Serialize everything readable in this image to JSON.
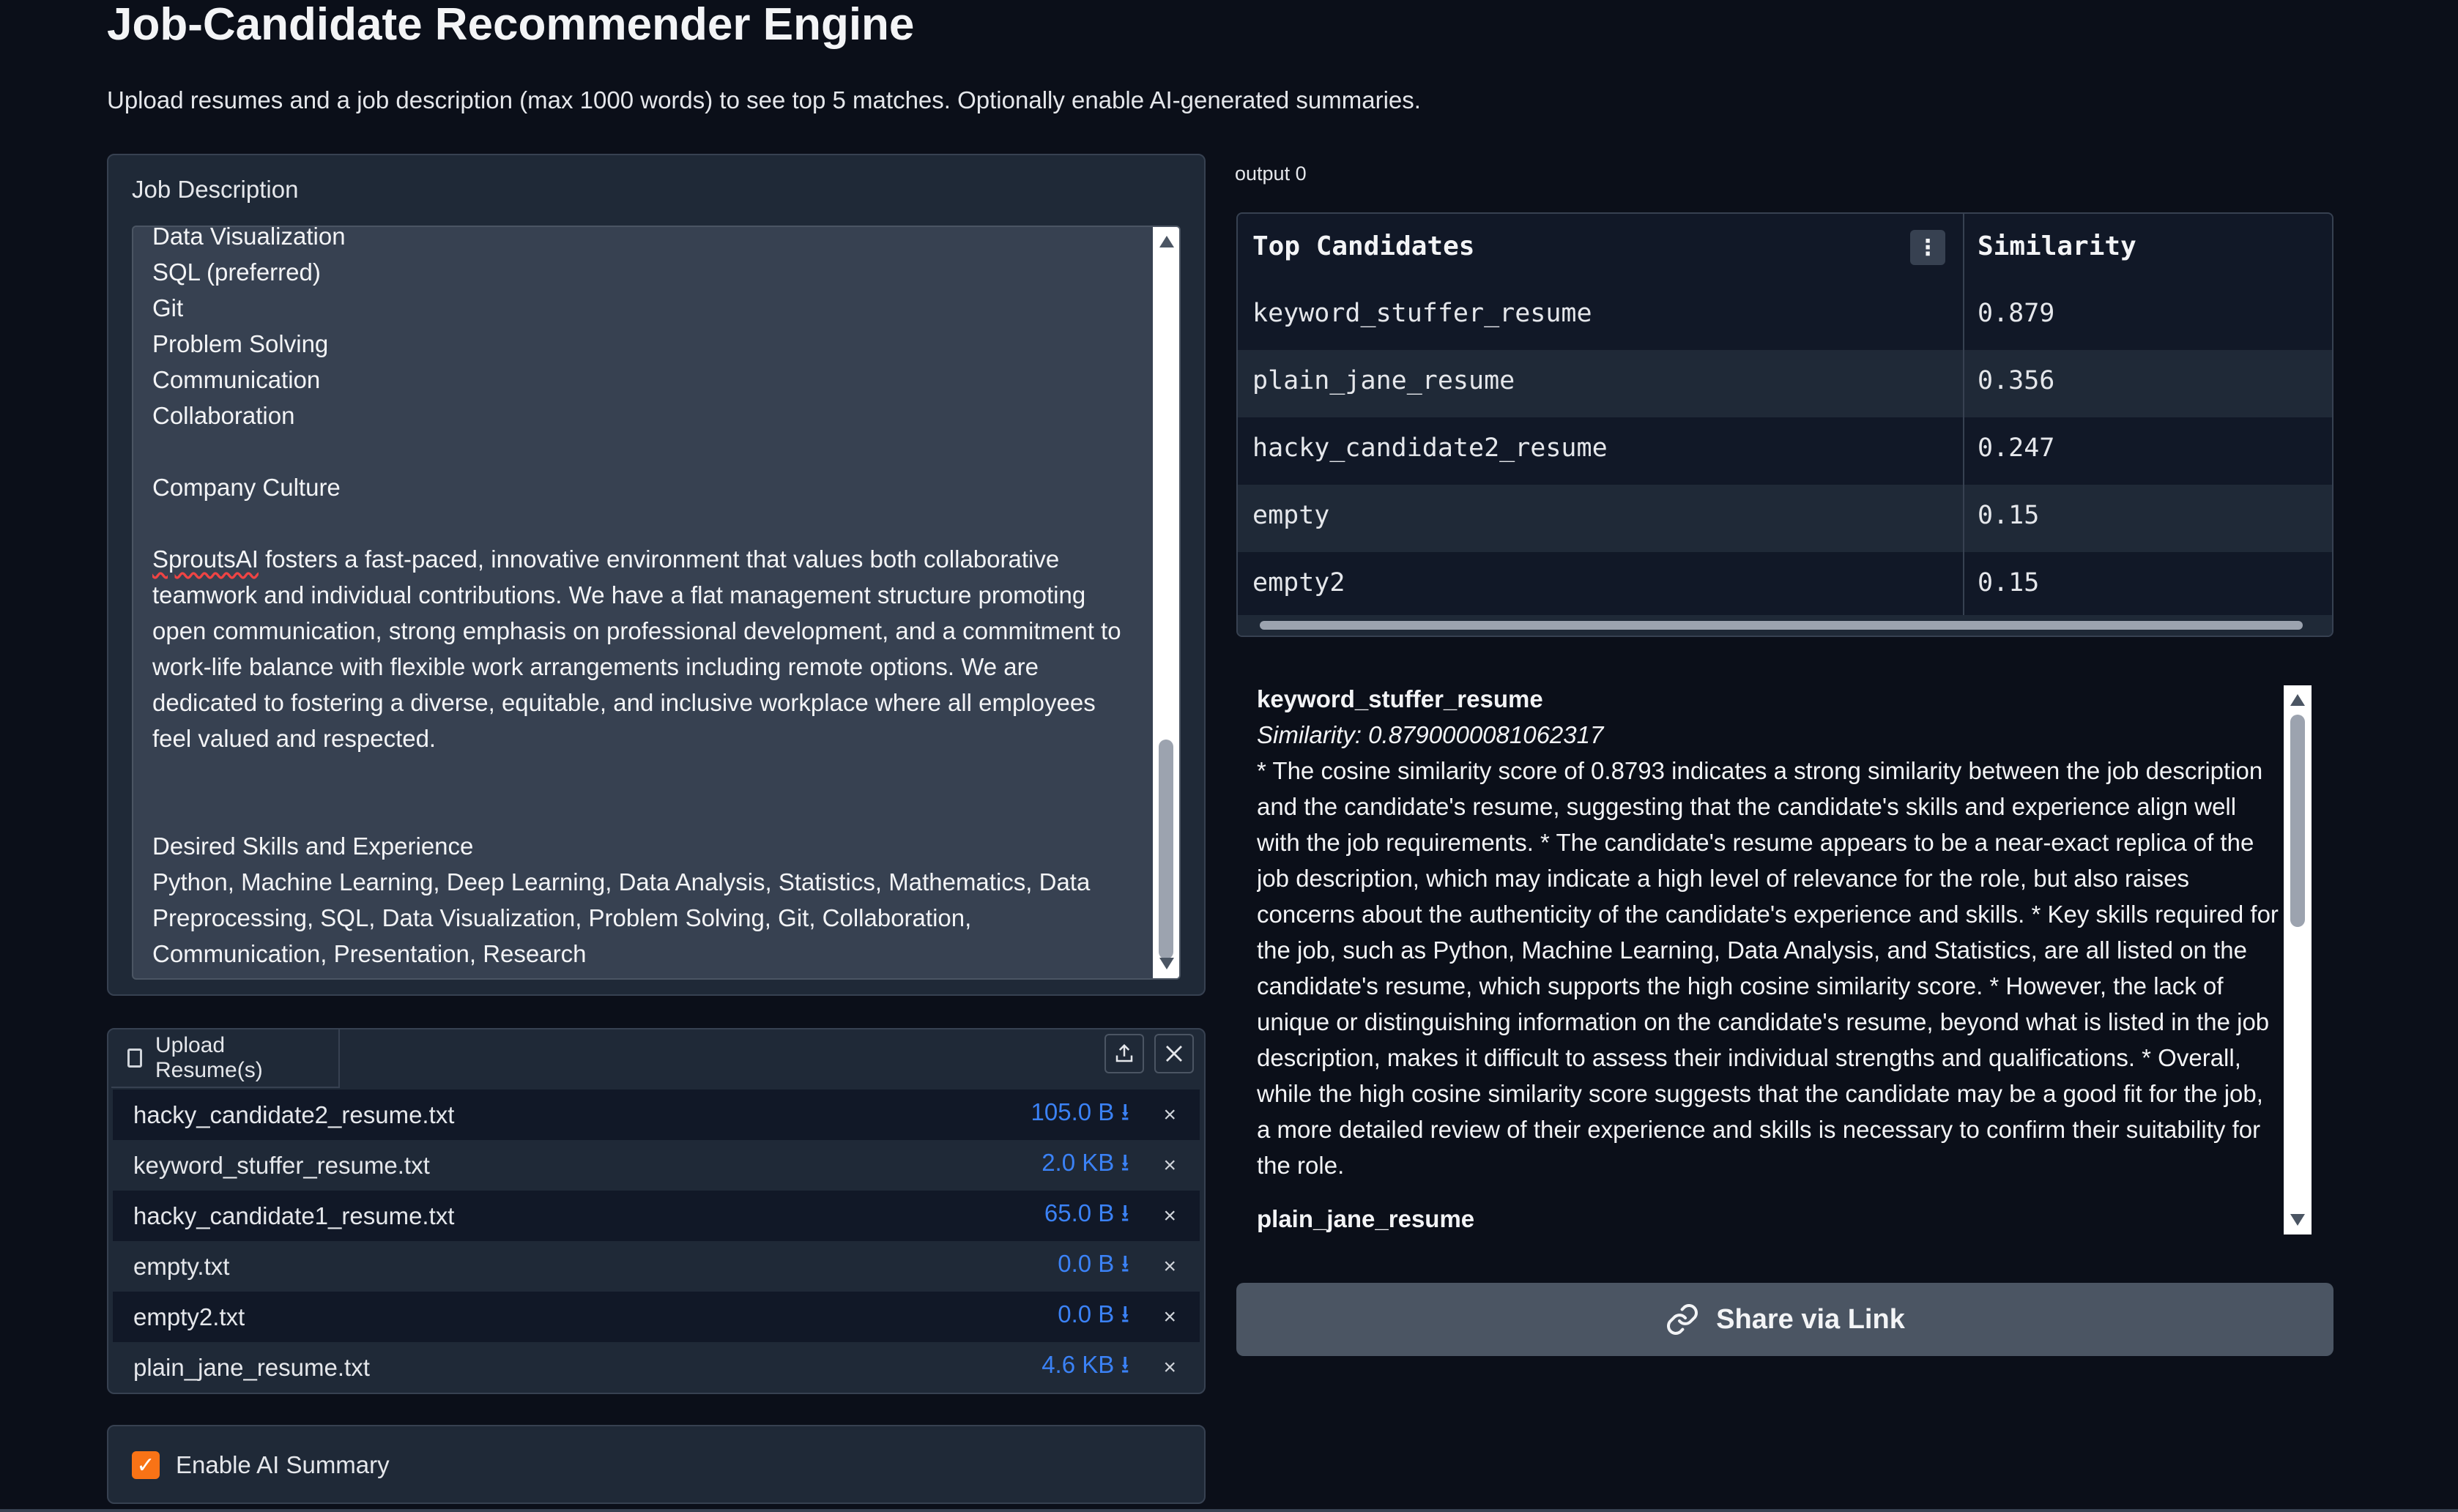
{
  "app": {
    "title": "Job-Candidate Recommender Engine",
    "subtitle": "Upload resumes and a job description (max 1000 words) to see top 5 matches. Optionally enable AI-generated summaries."
  },
  "job_description": {
    "label": "Job Description",
    "lines_before": "Data Visualization\nSQL (preferred)\nGit\nProblem Solving\nCommunication\nCollaboration\n\nCompany Culture\n\n",
    "misspelled_word": "SproutsAI",
    "lines_after": " fosters a fast-paced, innovative environment that values both collaborative\nteamwork and individual contributions. We have a flat management structure promoting\nopen communication, strong emphasis on professional development, and a commitment to\nwork-life balance with flexible work arrangements including remote options. We are\ndedicated to fostering a diverse, equitable, and inclusive workplace where all employees\nfeel valued and respected.\n\n\nDesired Skills and Experience\nPython, Machine Learning, Deep Learning, Data Analysis, Statistics, Mathematics, Data\nPreprocessing, SQL, Data Visualization, Problem Solving, Git, Collaboration,\nCommunication, Presentation, Research"
  },
  "upload": {
    "tab_label": "Upload Resume(s)",
    "upload_icon": "upload-icon",
    "clear_icon": "close-icon",
    "files": [
      {
        "name": "hacky_candidate2_resume.txt",
        "size": "105.0 B ⭳"
      },
      {
        "name": "keyword_stuffer_resume.txt",
        "size": "2.0 KB ⭳"
      },
      {
        "name": "hacky_candidate1_resume.txt",
        "size": "65.0 B ⭳"
      },
      {
        "name": "empty.txt",
        "size": "0.0 B ⭳"
      },
      {
        "name": "empty2.txt",
        "size": "0.0 B ⭳"
      },
      {
        "name": "plain_jane_resume.txt",
        "size": "4.6 KB ⭳"
      }
    ],
    "remove_glyph": "×"
  },
  "checkbox": {
    "label": "Enable AI Summary",
    "checked": true,
    "accent": "#f97316"
  },
  "output": {
    "label": "output 0",
    "headers": [
      "Top Candidates",
      "Similarity"
    ],
    "menu_glyph": "⋮",
    "rows": [
      {
        "candidate": "keyword_stuffer_resume",
        "similarity": "0.879"
      },
      {
        "candidate": "plain_jane_resume",
        "similarity": "0.356"
      },
      {
        "candidate": "hacky_candidate2_resume",
        "similarity": "0.247"
      },
      {
        "candidate": "empty",
        "similarity": "0.15"
      },
      {
        "candidate": "empty2",
        "similarity": "0.15"
      }
    ]
  },
  "summary": {
    "name": "keyword_stuffer_resume",
    "similarity": "Similarity: 0.8790000081062317",
    "body": "* The cosine similarity score of 0.8793 indicates a strong similarity between the job description and the candidate's resume, suggesting that the candidate's skills and experience align well with the job requirements. * The candidate's resume appears to be a near-exact replica of the job description, which may indicate a high level of relevance for the role, but also raises concerns about the authenticity of the candidate's experience and skills. * Key skills required for the job, such as Python, Machine Learning, Data Analysis, and Statistics, are all listed on the candidate's resume, which supports the high cosine similarity score. * However, the lack of unique or distinguishing information on the candidate's resume, beyond what is listed in the job description, makes it difficult to assess their individual strengths and qualifications. * Overall, while the high cosine similarity score suggests that the candidate may be a good fit for the job, a more detailed review of their experience and skills is necessary to confirm their suitability for the role.",
    "next_name": "plain_jane_resume"
  },
  "share": {
    "label": "Share via Link",
    "icon": "link-icon"
  },
  "colors": {
    "background": "#0b0f19",
    "panel": "#1f2937",
    "link": "#3b82f6",
    "button": "#4b5563"
  }
}
